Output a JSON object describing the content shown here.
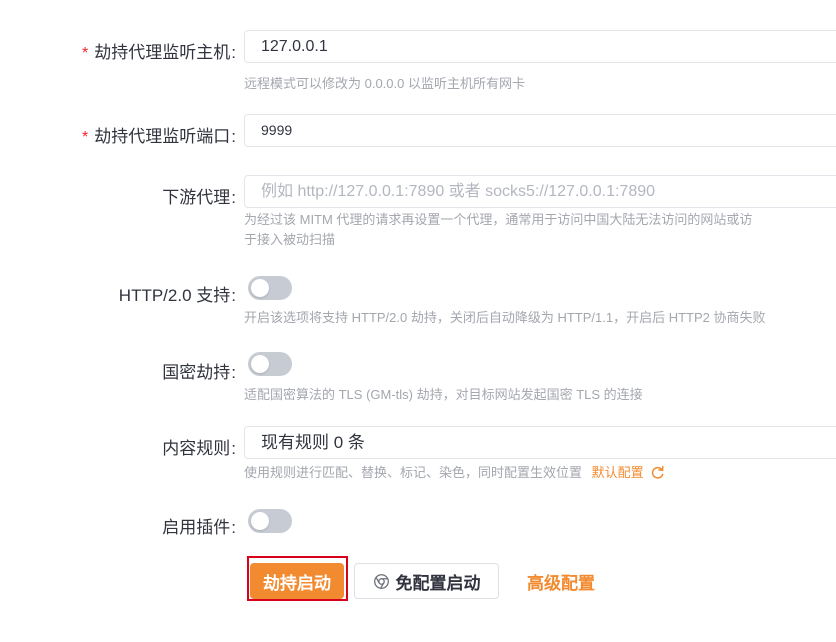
{
  "form": {
    "host": {
      "required_mark": "*",
      "label": "劫持代理监听主机",
      "colon": ":",
      "value": "127.0.0.1",
      "help": "远程模式可以修改为 0.0.0.0 以监听主机所有网卡"
    },
    "port": {
      "required_mark": "*",
      "label": "劫持代理监听端口",
      "colon": ":",
      "value": "9999"
    },
    "downstream": {
      "label": "下游代理",
      "colon": ":",
      "placeholder": "例如 http://127.0.0.1:7890 或者 socks5://127.0.0.1:7890",
      "help_line1": "为经过该 MITM 代理的请求再设置一个代理，通常用于访问中国大陆无法访问的网站或访",
      "help_line2": "于接入被动扫描"
    },
    "http2": {
      "label": "HTTP/2.0 支持",
      "colon": ":",
      "enabled": false,
      "help": "开启该选项将支持 HTTP/2.0 劫持，关闭后自动降级为 HTTP/1.1，开启后 HTTP2 协商失败"
    },
    "gm": {
      "label": "国密劫持",
      "colon": ":",
      "enabled": false,
      "help": "适配国密算法的 TLS (GM-tls) 劫持，对目标网站发起国密 TLS 的连接"
    },
    "rules": {
      "label": "内容规则",
      "colon": ":",
      "value": "现有规则 0 条",
      "help": "使用规则进行匹配、替换、标记、染色，同时配置生效位置",
      "default_link": "默认配置"
    },
    "plugins": {
      "label": "启用插件",
      "colon": ":",
      "enabled": false
    }
  },
  "actions": {
    "start": "劫持启动",
    "free_start": "免配置启动",
    "advanced": "高级配置"
  },
  "colors": {
    "accent": "#f28b30",
    "required": "#f5222d",
    "highlight_border": "#d9001b"
  },
  "icons": {
    "reset": "reset-icon",
    "chrome": "chrome-icon"
  }
}
